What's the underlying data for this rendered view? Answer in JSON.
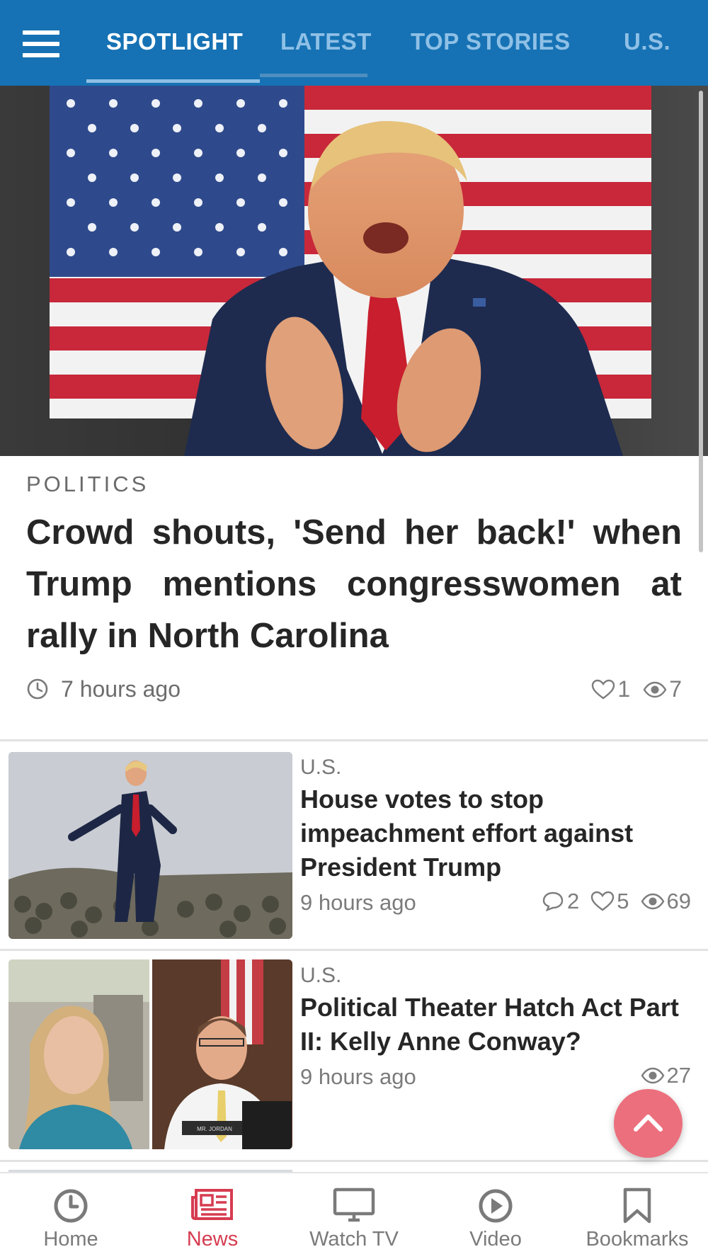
{
  "header": {
    "tabs": [
      {
        "label": "SPOTLIGHT",
        "active": true
      },
      {
        "label": "LATEST",
        "active": false
      },
      {
        "label": "TOP STORIES",
        "active": false
      },
      {
        "label": "U.S.",
        "active": false
      }
    ]
  },
  "hero": {
    "category": "POLITICS",
    "title": "Crowd shouts, 'Send her back!' when Trump mentions congresswomen at rally in North Carolina",
    "time": "7 hours ago",
    "likes": "1",
    "views": "7"
  },
  "stories": [
    {
      "category": "U.S.",
      "title": "House votes to stop impeachment effort against President Trump",
      "time": "9 hours ago",
      "comments": "2",
      "likes": "5",
      "views": "69"
    },
    {
      "category": "U.S.",
      "title": "Political Theater Hatch Act Part II: Kelly Anne Conway?",
      "time": "9 hours ago",
      "views": "27",
      "thumb_placard": "MR. JORDAN"
    }
  ],
  "bottom_nav": [
    {
      "label": "Home",
      "icon": "clock-icon",
      "active": false
    },
    {
      "label": "News",
      "icon": "newspaper-icon",
      "active": true
    },
    {
      "label": "Watch TV",
      "icon": "monitor-icon",
      "active": false
    },
    {
      "label": "Video",
      "icon": "play-icon",
      "active": false
    },
    {
      "label": "Bookmarks",
      "icon": "bookmark-icon",
      "active": false
    }
  ],
  "colors": {
    "header_bg": "#1672b4",
    "tab_inactive": "#8fc0e6",
    "fab": "#ec6f7d",
    "nav_active": "#d63c50"
  }
}
